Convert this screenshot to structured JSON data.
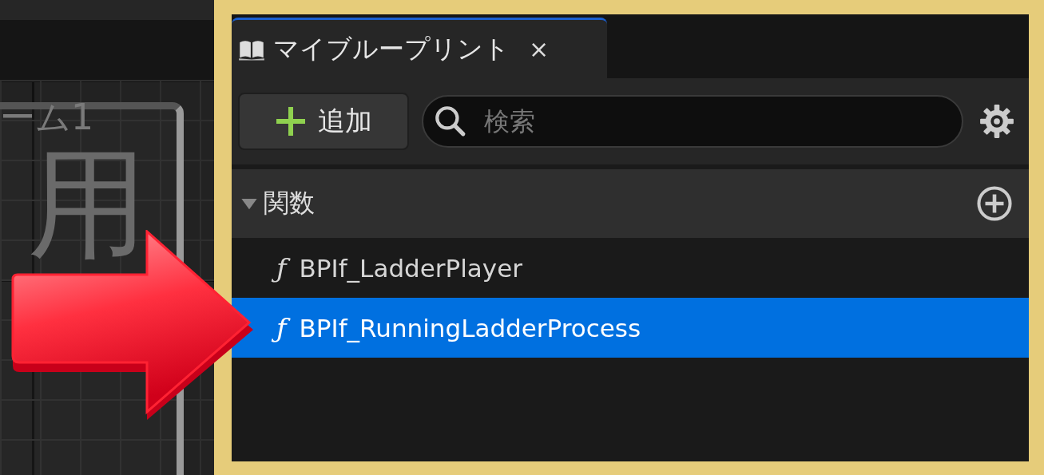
{
  "graph": {
    "zoom_label": "ーム1",
    "node_text": "用"
  },
  "tab": {
    "title": "マイブループリント",
    "close": "×",
    "selected": true
  },
  "toolbar": {
    "add_button": "追加",
    "search": {
      "placeholder": "検索"
    }
  },
  "sections": [
    {
      "title": "関数",
      "expanded": true,
      "items": [
        {
          "icon": "ƒ",
          "label": "BPIf_LadderPlayer",
          "selected": false
        },
        {
          "icon": "ƒ",
          "label": "BPIf_RunningLadderProcess",
          "selected": true
        }
      ]
    }
  ]
}
